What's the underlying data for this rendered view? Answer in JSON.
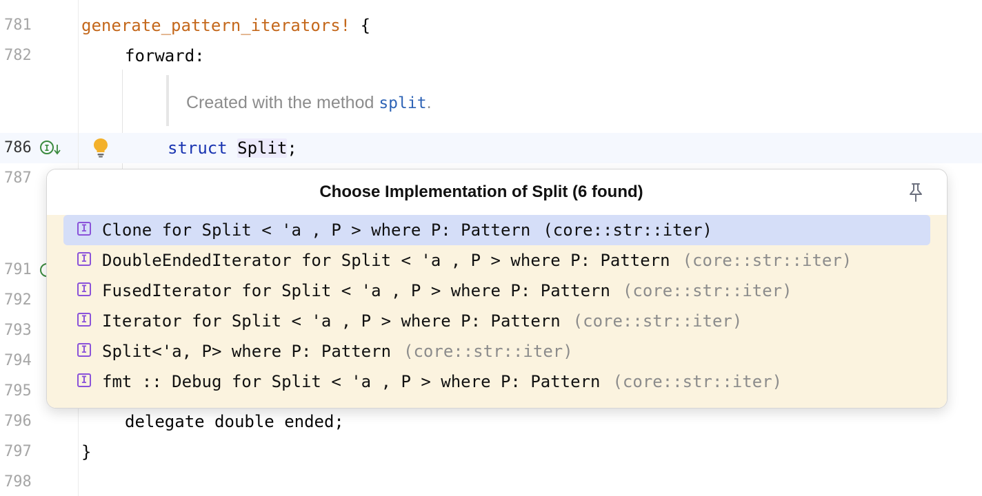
{
  "editor": {
    "lines": [
      {
        "num": "781",
        "text": ""
      },
      {
        "num": "782",
        "text": "forward:"
      },
      {
        "num": "786",
        "text": ""
      },
      {
        "num": "787",
        "text": ""
      },
      {
        "num": "791",
        "text": ""
      },
      {
        "num": "792",
        "text": ""
      },
      {
        "num": "793",
        "text": ""
      },
      {
        "num": "794",
        "text": ""
      },
      {
        "num": "795",
        "text": ""
      },
      {
        "num": "796",
        "text": "delegate double ended;"
      },
      {
        "num": "797",
        "text": "}"
      },
      {
        "num": "798",
        "text": ""
      }
    ],
    "macro_name": "generate_pattern_iterators!",
    "macro_brace": " {",
    "struct_keyword": "struct",
    "struct_name": "Split",
    "struct_semicolon": ";",
    "doc_text": "Created with the method ",
    "doc_link": "split",
    "doc_period": ".",
    "gutter_icons": [
      "implemented-icon",
      "lightbulb-icon"
    ]
  },
  "popup": {
    "title": "Choose Implementation of Split (6 found)",
    "pin_icon": "pin-icon",
    "items": [
      {
        "text": "Clone for Split < 'a , P > where P: Pattern",
        "location": "(core::str::iter)",
        "selected": true
      },
      {
        "text": "DoubleEndedIterator for Split < 'a , P > where P: Pattern",
        "location": "(core::str::iter)",
        "selected": false
      },
      {
        "text": "FusedIterator for Split < 'a , P > where P: Pattern",
        "location": "(core::str::iter)",
        "selected": false
      },
      {
        "text": "Iterator for Split < 'a , P > where P: Pattern",
        "location": "(core::str::iter)",
        "selected": false
      },
      {
        "text": "Split<'a, P> where P: Pattern",
        "location": "(core::str::iter)",
        "selected": false
      },
      {
        "text": "fmt :: Debug for Split < 'a , P > where P: Pattern",
        "location": "(core::str::iter)",
        "selected": false
      }
    ],
    "item_icon_glyph": "I"
  },
  "colors": {
    "selection": "#d5def8",
    "list_background": "#fbf3df",
    "macro": "#c4681c",
    "keyword": "#1a35b1",
    "interface_icon": "#8a52d9"
  }
}
